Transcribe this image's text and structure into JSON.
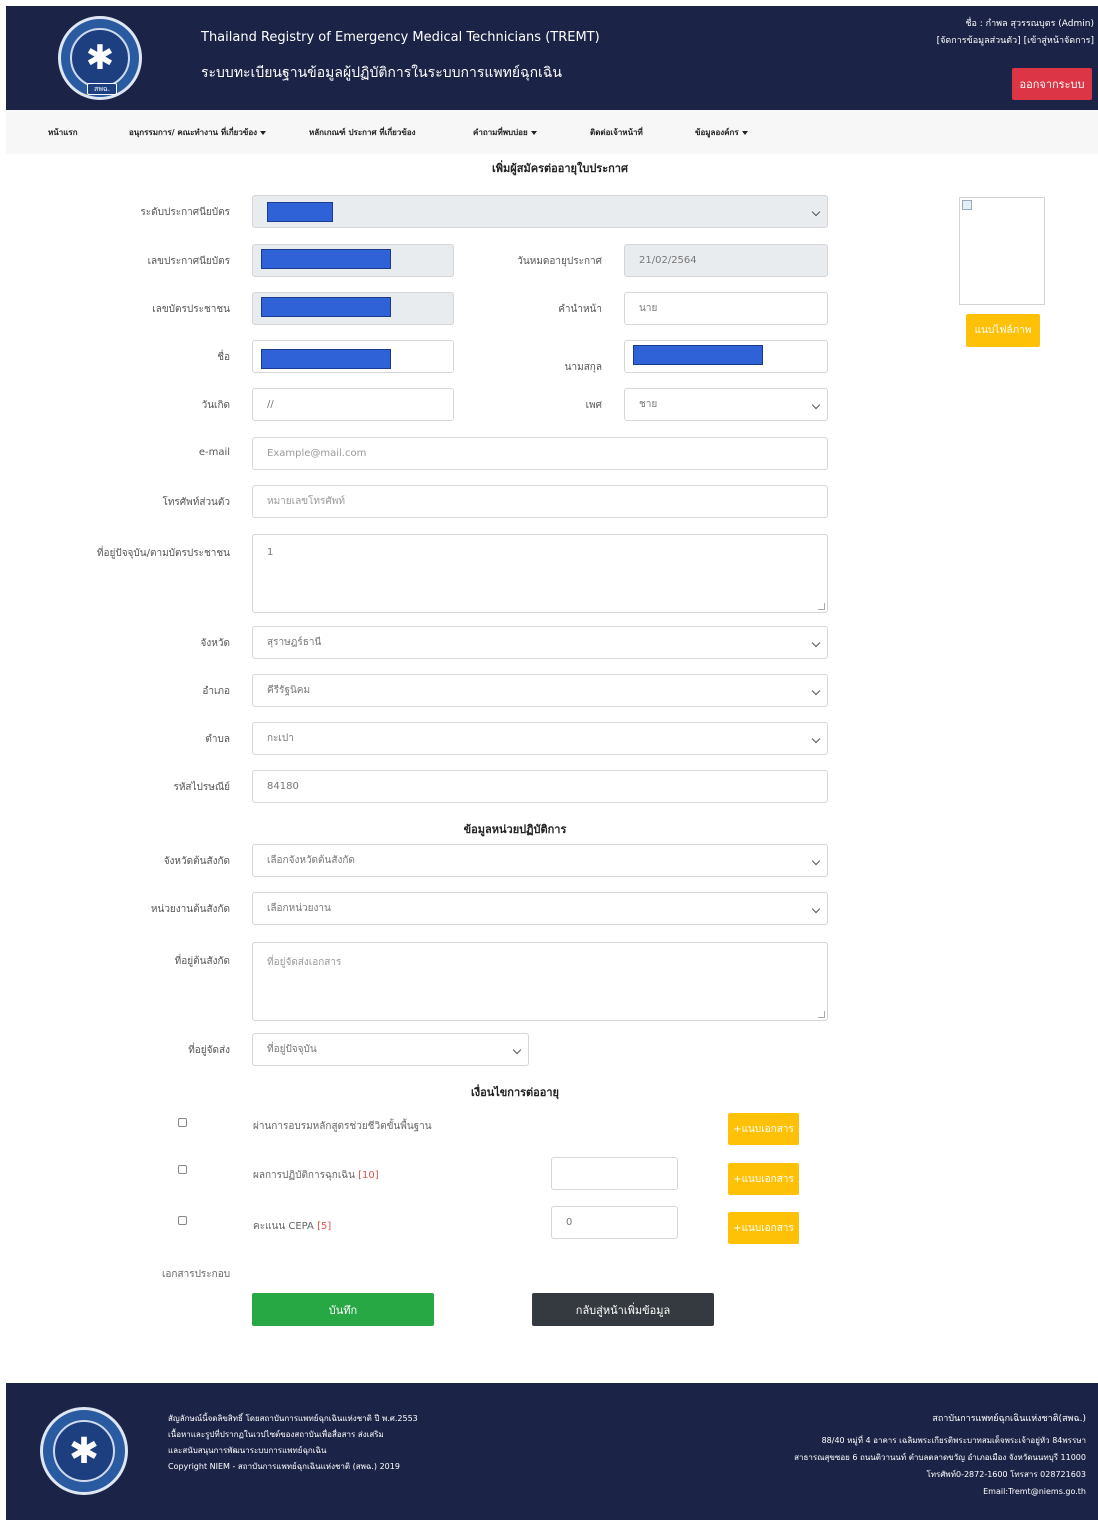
{
  "header": {
    "title_en": "Thailand Registry of Emergency Medical Technicians (TREMT)",
    "title_th": "ระบบทะเบียนฐานข้อมูลผู้ปฏิบัติการในระบบการแพทย์ฉุกเฉิน",
    "user": "ชื่อ : กำพล สุวรรณบุตร (Admin)",
    "link_profile": "[จัดการข้อมูลส่วนตัว]",
    "link_admin": "[เข้าสู่หน้าจัดการ]",
    "logout_label": "ออกจากระบบ",
    "logo_text": "สพฉ."
  },
  "nav": {
    "items": [
      {
        "label": "หน้าแรก",
        "dropdown": false
      },
      {
        "label": "อนุกรรมการ/ คณะทำงาน ที่เกี่ยวข้อง",
        "dropdown": true
      },
      {
        "label": "หลักเกณฑ์ ประกาศ ที่เกี่ยวข้อง",
        "dropdown": false
      },
      {
        "label": "คำถามที่พบบ่อย",
        "dropdown": true
      },
      {
        "label": "ติดต่อเจ้าหน้าที่",
        "dropdown": false
      },
      {
        "label": "ข้อมูลองค์กร",
        "dropdown": true
      }
    ]
  },
  "form": {
    "title": "เพิ่มผู้สมัครต่ออายุใบประกาศ",
    "cert_level_label": "ระดับประกาศนียบัตร",
    "cert_no_label": "เลขประกาศนียบัตร",
    "expiry_label": "วันหมดอายุประกาศ",
    "expiry_value": "21/02/2564",
    "id_card_label": "เลขบัตรประชาชน",
    "prefix_label": "คำนำหน้า",
    "prefix_value": "นาย",
    "first_name_label": "ชื่อ",
    "last_name_label": "นามสกุล",
    "birthdate_label": "วันเกิด",
    "birthdate_value": "//",
    "sex_label": "เพศ",
    "sex_value": "ชาย",
    "email_label": "e-mail",
    "email_placeholder": "Example@mail.com",
    "phone_label": "โทรศัพท์ส่วนตัว",
    "phone_placeholder": "หมายเลขโทรศัพท์",
    "address_label": "ที่อยู่ปัจจุบัน/ตามบัตรประชาชน",
    "address_value": "1",
    "province_label": "จังหวัด",
    "province_value": "สุราษฎร์ธานี",
    "district_label": "อำเภอ",
    "district_value": "คีรีรัฐนิคม",
    "subdistrict_label": "ตำบล",
    "subdistrict_value": "กะเปา",
    "postcode_label": "รหัสไปรษณีย์",
    "postcode_value": "84180",
    "attach_photo_label": "แนบไฟล์ภาพ"
  },
  "unit": {
    "title": "ข้อมูลหน่วยปฏิบัติการ",
    "province_label": "จังหวัดต้นสังกัด",
    "province_placeholder": "เลือกจังหวัดต้นสังกัด",
    "agency_label": "หน่วยงานต้นสังกัด",
    "agency_placeholder": "เลือกหน่วยงาน",
    "agency_address_label": "ที่อยู่ต้นสังกัด",
    "agency_address_placeholder": "ที่อยู่จัดส่งเอกสาร",
    "delivery_label": "ที่อยู่จัดส่ง",
    "delivery_value": "ที่อยู่ปัจจุบัน"
  },
  "conditions": {
    "title": "เงื่อนไขการต่ออายุ",
    "items": [
      {
        "label": "ผ่านการอบรมหลักสูตรช่วยชีวิตขั้นพื้นฐาน",
        "badge": "",
        "input": null,
        "checked": false
      },
      {
        "label": "ผลการปฏิบัติการฉุกเฉิน",
        "badge": "[10]",
        "input": "",
        "checked": false
      },
      {
        "label": "คะแนน CEPA",
        "badge": "[5]",
        "input": "0",
        "checked": false
      }
    ],
    "attach_doc_label": "+แนบเอกสาร",
    "docs_label": "เอกสารประกอบ"
  },
  "actions": {
    "save_label": "บันทึก",
    "back_label": "กลับสู่หน้าเพิ่มข้อมูล"
  },
  "footer": {
    "line1": "สัญลักษณ์นี้จดลิขสิทธิ์ โดยสถาบันการแพทย์ฉุกเฉินแห่งชาติ ปี พ.ศ.2553",
    "line2": "เนื้อหาและรูปที่ปรากฏในเวปไซต์ของสถาบันเพื่อสื่อสาร ส่งเสริม",
    "line3": "และสนับสนุนการพัฒนาระบบการแพทย์ฉุกเฉิน",
    "line4": "Copyright NIEM - สถาบันการแพทย์ฉุกเฉินแห่งชาติ (สพฉ.) 2019",
    "org": "สถาบันการแพทย์ฉุกเฉินแห่งชาติ(สพฉ.)",
    "addr1": "88/40 หมู่ที่ 4 อาคาร เฉลิมพระเกียรติพระบาทสมเด็จพระเจ้าอยู่หัว 84พรรษา",
    "addr2": "สาธารณสุขซอย 6 ถนนติวานนท์ ตำบลตลาดขวัญ อำเภอเมือง จังหวัดนนทบุรี 11000",
    "phone": "โทรศัพท์0-2872-1600 โทรสาร 028721603",
    "email": "Email:Tremt@niems.go.th"
  },
  "colors": {
    "header_bg": "#1b2346",
    "logout": "#dc3545",
    "attach": "#ffc107",
    "save": "#28a745",
    "back": "#343a40",
    "redaction": "#2f62d6"
  }
}
